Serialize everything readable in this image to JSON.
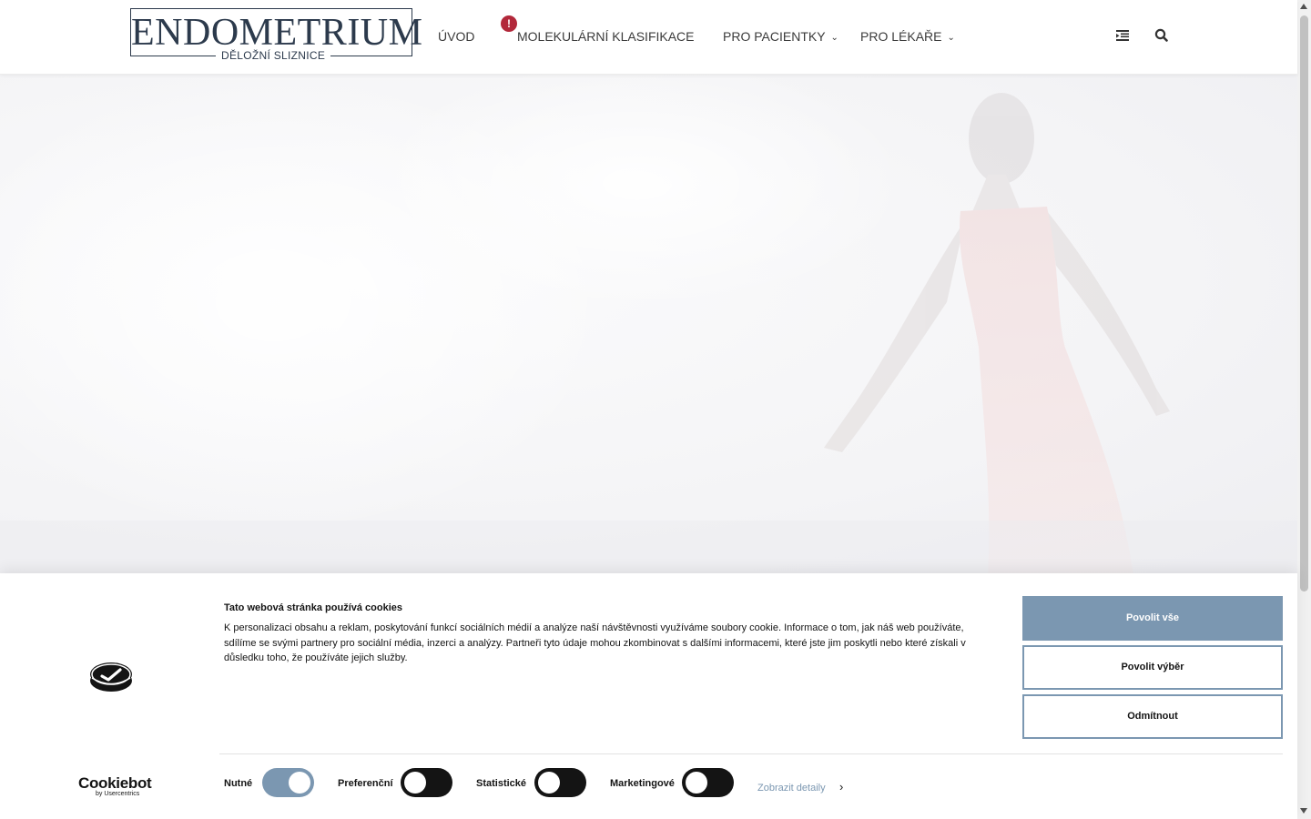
{
  "header": {
    "logo_title": "ENDOMETRIUM",
    "logo_subtitle": "DĚLOŽNÍ SLIZNICE",
    "nav": [
      {
        "label": "ÚVOD"
      },
      {
        "label": "MOLEKULÁRNÍ KLASIFIKACE",
        "badge": "!"
      },
      {
        "label": "PRO PACIENTKY",
        "has_dropdown": true
      },
      {
        "label": "PRO LÉKAŘE",
        "has_dropdown": true
      }
    ],
    "icons": [
      "menu-indent-icon",
      "search-icon"
    ]
  },
  "cookie_banner": {
    "brand": "Cookiebot",
    "brand_sub": "by Usercentrics",
    "title": "Tato webová stránka používá cookies",
    "text": "K personalizaci obsahu a reklam, poskytování funkcí sociálních médií a analýze naší návštěvnosti využíváme soubory cookie. Informace o tom, jak náš web používáte, sdílíme se svými partnery pro sociální média, inzerci a analýzy. Partneři tyto údaje mohou zkombinovat s dalšími informacemi, které jste jim poskytli nebo které získali v důsledku toho, že používáte jejich služby.",
    "buttons": {
      "allow_all": "Povolit vše",
      "allow_selection": "Povolit výběr",
      "deny": "Odmítnout"
    },
    "toggles": [
      {
        "label": "Nutné",
        "on": true
      },
      {
        "label": "Preferenční",
        "on": false
      },
      {
        "label": "Statistické",
        "on": false
      },
      {
        "label": "Marketingové",
        "on": false
      }
    ],
    "details_link": "Zobrazit detaily"
  },
  "colors": {
    "accent": "#7b97b1",
    "badge": "#b2283a",
    "logo": "#2c3a4c"
  }
}
